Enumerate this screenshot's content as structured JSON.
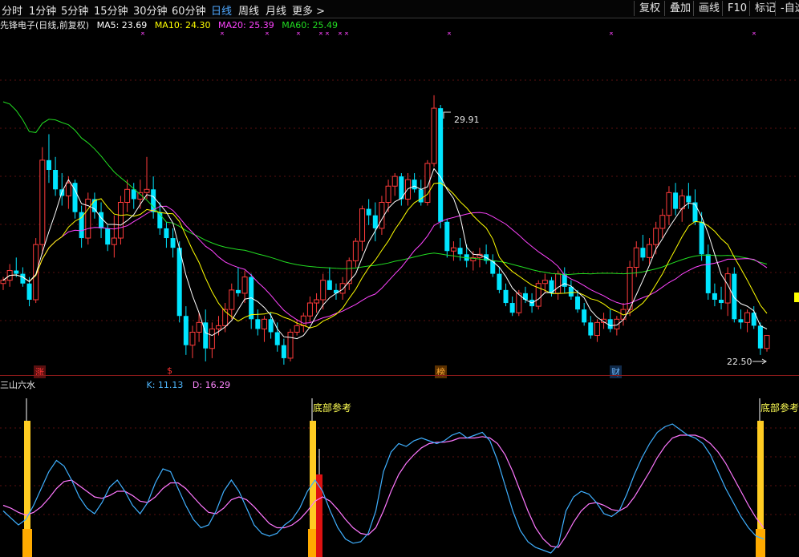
{
  "toolbar": {
    "periods": [
      "分时",
      "1分钟",
      "5分钟",
      "15分钟",
      "30分钟",
      "60分钟",
      "日线",
      "周线",
      "月线",
      "更多 >"
    ],
    "active_index": 6,
    "right_buttons": [
      "复权",
      "叠加",
      "画线",
      "F10",
      "标记",
      "-自选"
    ]
  },
  "legend": {
    "title": "先锋电子(日线,前复权)",
    "ma5": "MA5: 23.69",
    "ma10": "MA10: 24.30",
    "ma20": "MA20: 25.39",
    "ma60": "MA60: 25.49",
    "colors": {
      "ma5": "#ffffff",
      "ma10": "#ffff00",
      "ma20": "#ff44ff",
      "ma60": "#22dd22"
    }
  },
  "price_labels": {
    "high": "29.91",
    "low": "22.50"
  },
  "event_marks": [
    {
      "text": "涨",
      "color": "#ff3333",
      "bg": "#5a1010"
    },
    {
      "text": "$",
      "color": "#ff3333",
      "bg": "#000000"
    },
    {
      "text": "榜",
      "color": "#ffaa33",
      "bg": "#5a3000"
    },
    {
      "text": "财",
      "color": "#6fb8ff",
      "bg": "#102a4a"
    }
  ],
  "sub_legend": {
    "name": "三山六水",
    "k": "K: 11.13",
    "d": "D: 16.29"
  },
  "signal_labels": [
    "底部参考",
    "底部参考"
  ],
  "chart_data": {
    "type": "candlestick",
    "ylim": [
      21.6,
      31.6
    ],
    "candles": [
      [
        24.1,
        24.3,
        23.9,
        24.2
      ],
      [
        24.2,
        24.7,
        24.0,
        24.5
      ],
      [
        24.5,
        24.9,
        24.3,
        24.4
      ],
      [
        24.4,
        24.6,
        24.0,
        24.1
      ],
      [
        24.1,
        24.3,
        23.4,
        23.6
      ],
      [
        23.6,
        25.5,
        23.5,
        25.3
      ],
      [
        25.3,
        28.3,
        25.0,
        27.9
      ],
      [
        27.9,
        28.7,
        27.2,
        27.6
      ],
      [
        27.6,
        28.0,
        26.8,
        27.0
      ],
      [
        27.0,
        27.5,
        26.5,
        26.8
      ],
      [
        26.8,
        27.4,
        26.4,
        27.2
      ],
      [
        27.2,
        27.3,
        26.1,
        26.3
      ],
      [
        26.3,
        26.5,
        25.2,
        25.5
      ],
      [
        25.5,
        26.9,
        25.3,
        26.7
      ],
      [
        26.7,
        26.9,
        26.1,
        26.3
      ],
      [
        26.3,
        26.6,
        25.5,
        25.8
      ],
      [
        25.8,
        25.9,
        25.1,
        25.3
      ],
      [
        25.3,
        26.2,
        24.9,
        25.5
      ],
      [
        25.5,
        26.8,
        25.3,
        26.6
      ],
      [
        26.6,
        27.3,
        26.3,
        27.0
      ],
      [
        27.0,
        27.2,
        26.4,
        26.7
      ],
      [
        26.7,
        27.3,
        26.4,
        26.9
      ],
      [
        26.9,
        28.0,
        26.7,
        27.0
      ],
      [
        27.0,
        27.4,
        26.1,
        26.3
      ],
      [
        26.3,
        26.6,
        25.6,
        25.8
      ],
      [
        25.8,
        26.0,
        25.2,
        25.5
      ],
      [
        25.5,
        25.8,
        24.9,
        25.2
      ],
      [
        25.2,
        25.4,
        22.9,
        23.1
      ],
      [
        23.1,
        23.4,
        21.9,
        22.2
      ],
      [
        22.2,
        22.8,
        21.8,
        22.6
      ],
      [
        22.6,
        23.2,
        22.3,
        22.9
      ],
      [
        22.9,
        23.3,
        21.7,
        22.1
      ],
      [
        22.1,
        22.9,
        21.8,
        22.7
      ],
      [
        22.7,
        23.1,
        22.5,
        22.8
      ],
      [
        22.8,
        23.5,
        22.6,
        23.3
      ],
      [
        23.3,
        24.1,
        23.0,
        23.9
      ],
      [
        23.9,
        24.6,
        23.7,
        23.8
      ],
      [
        23.8,
        24.5,
        23.5,
        24.3
      ],
      [
        24.3,
        24.4,
        22.7,
        23.0
      ],
      [
        23.0,
        23.3,
        22.5,
        22.7
      ],
      [
        22.7,
        23.1,
        22.3,
        23.0
      ],
      [
        23.0,
        23.2,
        22.4,
        22.6
      ],
      [
        22.6,
        22.9,
        22.0,
        22.2
      ],
      [
        22.2,
        22.4,
        21.6,
        21.8
      ],
      [
        21.8,
        22.7,
        21.7,
        22.6
      ],
      [
        22.6,
        23.0,
        22.5,
        22.8
      ],
      [
        22.8,
        23.2,
        22.6,
        23.1
      ],
      [
        23.1,
        23.7,
        22.9,
        23.5
      ],
      [
        23.5,
        23.8,
        23.2,
        23.6
      ],
      [
        23.6,
        24.4,
        23.3,
        24.2
      ],
      [
        24.2,
        24.6,
        23.9,
        23.9
      ],
      [
        23.9,
        24.1,
        23.6,
        23.8
      ],
      [
        23.8,
        24.3,
        23.6,
        24.1
      ],
      [
        24.1,
        24.9,
        23.9,
        24.8
      ],
      [
        24.8,
        25.5,
        24.6,
        25.4
      ],
      [
        25.4,
        26.5,
        25.1,
        26.4
      ],
      [
        26.4,
        26.7,
        25.9,
        26.2
      ],
      [
        26.2,
        26.6,
        25.4,
        25.8
      ],
      [
        25.8,
        26.8,
        25.6,
        26.6
      ],
      [
        26.6,
        27.3,
        26.3,
        27.1
      ],
      [
        27.1,
        27.5,
        26.8,
        27.4
      ],
      [
        27.4,
        27.5,
        26.5,
        26.7
      ],
      [
        26.7,
        27.5,
        26.5,
        27.3
      ],
      [
        27.3,
        27.5,
        26.9,
        27.0
      ],
      [
        27.0,
        27.3,
        26.5,
        26.6
      ],
      [
        26.6,
        27.9,
        26.5,
        27.8
      ],
      [
        27.8,
        29.9,
        27.7,
        29.5
      ],
      [
        29.5,
        29.6,
        25.8,
        26.0
      ],
      [
        26.0,
        26.1,
        24.9,
        25.1
      ],
      [
        25.1,
        25.4,
        24.8,
        25.2
      ],
      [
        25.2,
        25.5,
        24.8,
        25.0
      ],
      [
        25.0,
        25.3,
        24.6,
        24.8
      ],
      [
        24.8,
        25.1,
        24.5,
        24.9
      ],
      [
        24.9,
        25.2,
        24.6,
        25.0
      ],
      [
        25.0,
        25.3,
        24.7,
        24.8
      ],
      [
        24.8,
        25.0,
        24.3,
        24.4
      ],
      [
        24.4,
        24.6,
        23.8,
        23.9
      ],
      [
        23.9,
        24.1,
        23.4,
        23.5
      ],
      [
        23.5,
        23.7,
        23.1,
        23.2
      ],
      [
        23.2,
        23.9,
        23.1,
        23.8
      ],
      [
        23.8,
        24.0,
        23.5,
        23.6
      ],
      [
        23.6,
        23.8,
        23.2,
        23.4
      ],
      [
        23.4,
        24.2,
        23.3,
        24.1
      ],
      [
        24.1,
        24.4,
        23.8,
        24.2
      ],
      [
        24.2,
        24.3,
        23.7,
        23.8
      ],
      [
        23.8,
        24.5,
        23.6,
        24.4
      ],
      [
        24.4,
        24.6,
        23.8,
        24.0
      ],
      [
        24.0,
        24.2,
        23.6,
        23.7
      ],
      [
        23.7,
        23.9,
        23.2,
        23.3
      ],
      [
        23.3,
        23.5,
        22.8,
        22.9
      ],
      [
        22.9,
        23.1,
        22.4,
        22.5
      ],
      [
        22.5,
        23.0,
        22.3,
        22.9
      ],
      [
        22.9,
        23.2,
        22.7,
        23.0
      ],
      [
        23.0,
        23.3,
        22.6,
        22.7
      ],
      [
        22.7,
        23.1,
        22.5,
        23.0
      ],
      [
        23.0,
        23.5,
        22.8,
        23.3
      ],
      [
        23.3,
        24.8,
        23.1,
        24.6
      ],
      [
        24.6,
        25.4,
        24.3,
        25.2
      ],
      [
        25.2,
        25.6,
        24.8,
        24.9
      ],
      [
        24.9,
        25.5,
        24.7,
        25.3
      ],
      [
        25.3,
        26.0,
        25.0,
        25.8
      ],
      [
        25.8,
        26.4,
        25.5,
        26.2
      ],
      [
        26.2,
        27.1,
        25.9,
        26.9
      ],
      [
        26.9,
        27.2,
        26.2,
        26.4
      ],
      [
        26.4,
        27.0,
        26.0,
        26.8
      ],
      [
        26.8,
        27.2,
        26.4,
        26.6
      ],
      [
        26.6,
        27.0,
        25.9,
        26.0
      ],
      [
        26.0,
        26.3,
        24.8,
        25.0
      ],
      [
        25.0,
        25.3,
        23.6,
        23.8
      ],
      [
        23.8,
        24.1,
        23.4,
        23.6
      ],
      [
        23.6,
        24.0,
        23.3,
        23.5
      ],
      [
        23.5,
        24.6,
        23.1,
        24.4
      ],
      [
        24.4,
        24.6,
        22.9,
        23.0
      ],
      [
        23.0,
        23.3,
        22.7,
        22.9
      ],
      [
        22.9,
        23.3,
        22.6,
        23.2
      ],
      [
        23.2,
        23.4,
        22.7,
        22.8
      ],
      [
        22.8,
        22.9,
        21.9,
        22.1
      ],
      [
        22.1,
        22.5,
        22.0,
        22.5
      ]
    ],
    "k_series": [
      30,
      25,
      20,
      24,
      34,
      46,
      58,
      66,
      62,
      52,
      40,
      32,
      28,
      36,
      47,
      52,
      44,
      34,
      28,
      36,
      50,
      60,
      58,
      46,
      34,
      24,
      18,
      20,
      30,
      44,
      52,
      44,
      32,
      20,
      14,
      12,
      14,
      20,
      24,
      32,
      44,
      52,
      44,
      30,
      18,
      10,
      7,
      8,
      14,
      30,
      58,
      72,
      78,
      76,
      80,
      82,
      80,
      78,
      80,
      84,
      86,
      82,
      84,
      86,
      80,
      66,
      48,
      30,
      16,
      8,
      4,
      2,
      0,
      6,
      30,
      40,
      44,
      42,
      36,
      28,
      26,
      30,
      42,
      56,
      68,
      78,
      86,
      90,
      92,
      88,
      84,
      82,
      78,
      70,
      58,
      46,
      36,
      26,
      18,
      12,
      10
    ],
    "d_series": [
      34,
      32,
      29,
      27,
      29,
      33,
      39,
      46,
      51,
      52,
      48,
      44,
      40,
      39,
      41,
      44,
      44,
      41,
      37,
      36,
      40,
      46,
      50,
      50,
      46,
      40,
      34,
      29,
      28,
      32,
      38,
      40,
      38,
      33,
      27,
      21,
      18,
      18,
      20,
      24,
      30,
      37,
      40,
      37,
      31,
      24,
      18,
      14,
      13,
      18,
      30,
      44,
      56,
      64,
      70,
      75,
      78,
      79,
      79,
      80,
      82,
      82,
      82,
      83,
      82,
      78,
      70,
      58,
      44,
      30,
      18,
      10,
      5,
      4,
      12,
      22,
      30,
      35,
      36,
      34,
      31,
      30,
      33,
      40,
      49,
      58,
      68,
      76,
      82,
      84,
      84,
      84,
      82,
      78,
      72,
      64,
      54,
      44,
      34,
      25,
      18
    ]
  }
}
